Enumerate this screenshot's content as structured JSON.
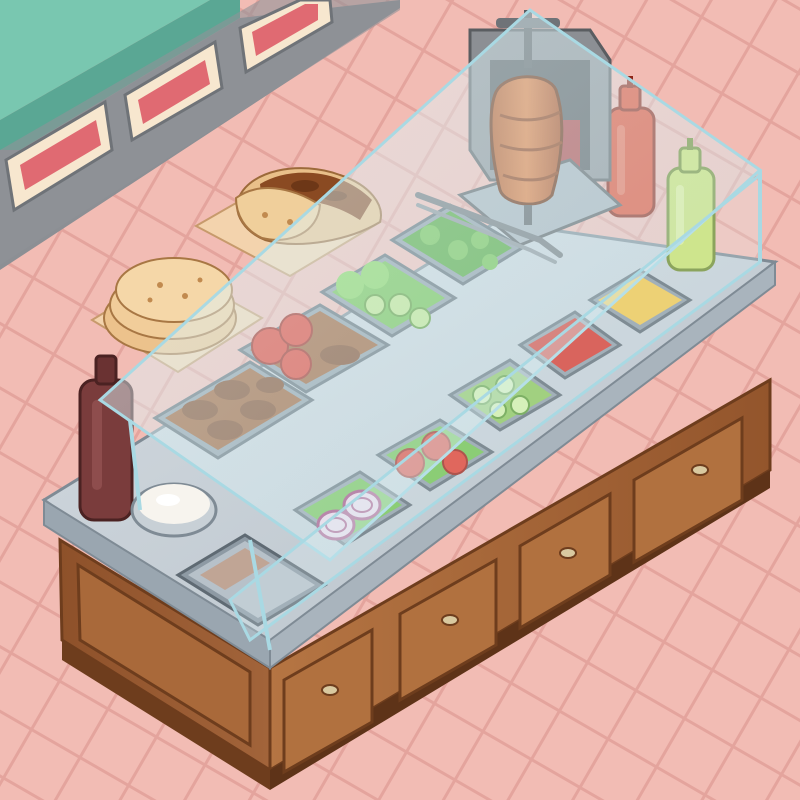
{
  "scene": {
    "palette": {
      "floor": "#f2bcb4",
      "floor_grout": "#e7a9a2",
      "teal_counter": "#79c7b0",
      "counter_front": "#8c8f94",
      "steel_top": "#c6cfd6",
      "steel_edge": "#9aa6b0",
      "wood": "#a8683a",
      "wood_dark": "#7a4622",
      "glass": "#d9f1f6",
      "meat": "#9c5a2e",
      "lettuce": "#6fc04a",
      "tomato": "#e0392a",
      "cucumber": "#a8d66a",
      "onion": "#c2508b",
      "corn": "#f2c64a",
      "sauce_red": "#d7352a",
      "ketchup": "#e24a2e",
      "mustard_bottle": "#c9e06a",
      "brown_bottle": "#7a3c3c",
      "yogurt": "#f7f4ee"
    },
    "back_counter": {
      "name": "back-display-counter",
      "trays": [
        "salami-tray",
        "salami-tray",
        "salami-tray",
        "salami-tray"
      ]
    },
    "prep_area": {
      "items": [
        {
          "name": "wrapped-shawarma",
          "interactable": true
        },
        {
          "name": "pita-stack",
          "interactable": true
        }
      ]
    },
    "doner": {
      "name": "doner-rotisserie",
      "interactable": true
    },
    "condiments": [
      {
        "name": "ketchup-bottle",
        "color": "#e24a2e"
      },
      {
        "name": "mustard-bottle",
        "color": "#c9e06a"
      },
      {
        "name": "bbq-sauce-bottle",
        "color": "#7a3c3c"
      },
      {
        "name": "yogurt-sauce-bowl",
        "color": "#f7f4ee"
      }
    ],
    "bins": [
      {
        "name": "bin-meat-rolls",
        "fill": "meat"
      },
      {
        "name": "bin-tomato-and-meat",
        "fill": "tomato_meat"
      },
      {
        "name": "bin-lettuce-cucumber",
        "fill": "lettuce_cucumber"
      },
      {
        "name": "bin-lettuce",
        "fill": "lettuce"
      },
      {
        "name": "bin-corn",
        "fill": "corn"
      },
      {
        "name": "bin-red-sauce",
        "fill": "sauce_red"
      },
      {
        "name": "bin-cucumber",
        "fill": "cucumber"
      },
      {
        "name": "bin-tomato-slices",
        "fill": "tomato"
      },
      {
        "name": "bin-red-onion",
        "fill": "onion"
      },
      {
        "name": "bin-empty",
        "fill": "empty"
      }
    ],
    "drawers": [
      {
        "name": "drawer-1"
      },
      {
        "name": "drawer-2"
      },
      {
        "name": "drawer-3"
      },
      {
        "name": "drawer-4"
      },
      {
        "name": "drawer-5"
      }
    ]
  }
}
